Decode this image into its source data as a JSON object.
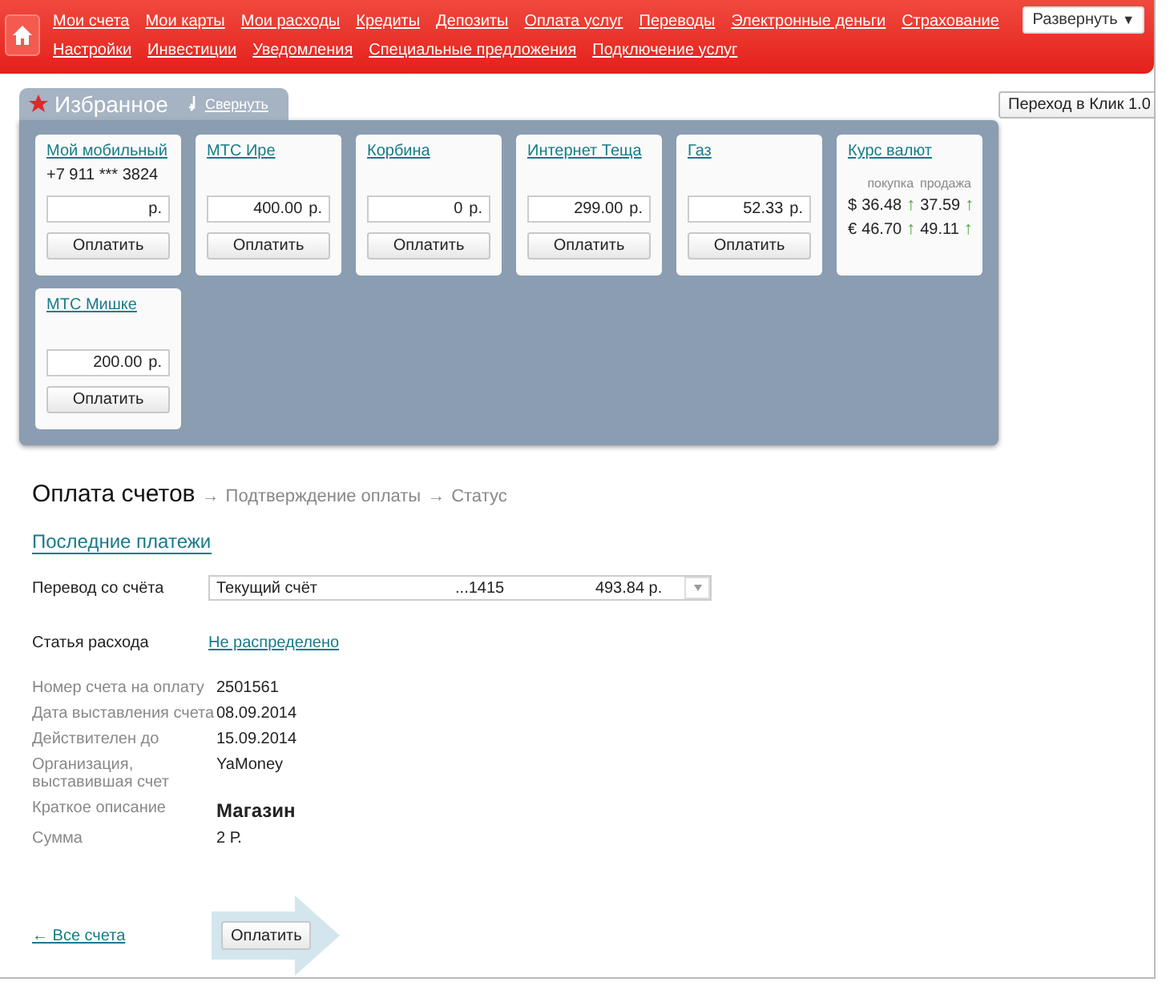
{
  "nav": {
    "main_links": [
      "Мои счета",
      "Мои карты",
      "Мои расходы",
      "Кредиты",
      "Депозиты",
      "Оплата услуг",
      "Переводы",
      "Электронные деньги",
      "Страхование"
    ],
    "extra_links": [
      "Настройки",
      "Инвестиции",
      "Уведомления",
      "Специальные предложения",
      "Подключение услуг"
    ],
    "expand_button": "Развернуть",
    "expand_arrow": "▼"
  },
  "klik_button": "Переход в Клик 1.0",
  "favorites": {
    "title": "Избранное",
    "collapse_link": "Свернуть",
    "cards": [
      {
        "kind": "payment",
        "title": "Мой мобильный",
        "phone": "+7 911 *** 3824",
        "currency": "р.",
        "button": "Оплатить"
      },
      {
        "kind": "payment",
        "title": "МТС Ире",
        "amount": "400.00",
        "currency": "р.",
        "button": "Оплатить"
      },
      {
        "kind": "payment",
        "title": "Корбина",
        "amount": "0",
        "currency": "р.",
        "button": "Оплатить"
      },
      {
        "kind": "payment",
        "title": "Интернет Теща",
        "amount": "299.00",
        "currency": "р.",
        "button": "Оплатить"
      },
      {
        "kind": "payment",
        "title": "Газ",
        "amount": "52.33",
        "currency": "р.",
        "button": "Оплатить"
      },
      {
        "kind": "rates",
        "title": "Курс валют",
        "headers": [
          "покупка",
          "продажа"
        ],
        "rows": [
          {
            "symbol": "$",
            "buy": "36.48",
            "buy_arrow": "↑",
            "sell": "37.59",
            "sell_arrow": "↑"
          },
          {
            "symbol": "€",
            "buy": "46.70",
            "buy_arrow": "↑",
            "sell": "49.11",
            "sell_arrow": "↑"
          }
        ]
      },
      {
        "kind": "payment",
        "title": "МТС Мишке",
        "amount": "200.00",
        "currency": "р.",
        "button": "Оплатить"
      }
    ]
  },
  "steps": [
    {
      "label": "Оплата счетов",
      "selected": true
    },
    {
      "prefix": "→",
      "label": "Подтверждение оплаты",
      "selected": false
    },
    {
      "prefix": "→",
      "label": "Статус",
      "selected": false
    }
  ],
  "recent_link": "Последние платежи",
  "from_account": {
    "label": "Перевод со счёта",
    "account": "Текущий счёт",
    "number": "...1415",
    "balance": "493.84 р."
  },
  "expense": {
    "label": "Статья расхода",
    "link": "Не распределено"
  },
  "details": [
    {
      "label": "Номер счета на оплату",
      "value": "2501561",
      "kind": "plain"
    },
    {
      "label": "Дата выставления счета",
      "value": "08.09.2014",
      "kind": "plain"
    },
    {
      "label": "Действителен до",
      "value": "15.09.2014",
      "kind": "plain"
    },
    {
      "label": "Организация, выставившая счет",
      "value": "YaMoney",
      "kind": "plain"
    },
    {
      "label": "Краткое описание",
      "value": "Магазин",
      "kind": "bold"
    },
    {
      "label": "Сумма",
      "value": "2 Р.",
      "kind": "plain"
    }
  ],
  "back_link": "← Все счета",
  "pay_button": "Оплатить"
}
